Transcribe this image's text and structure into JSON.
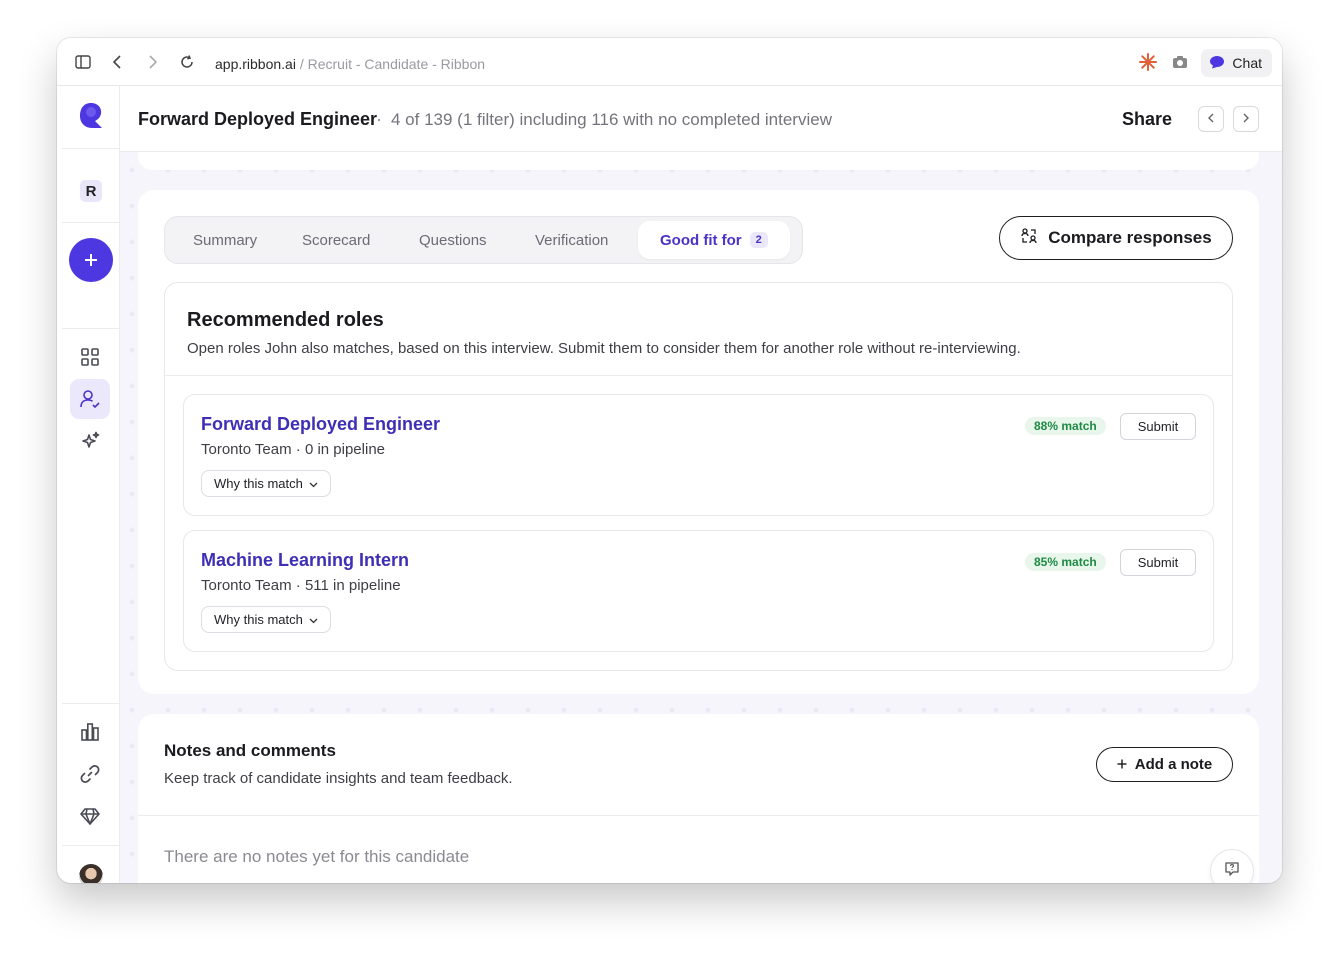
{
  "browser": {
    "url_domain": "app.ribbon.ai",
    "url_path": " / Recruit - Candidate - Ribbon",
    "chat_label": "Chat"
  },
  "rail": {
    "workspace_initial": "R",
    "new_label": "+"
  },
  "header": {
    "title": "Forward Deployed Engineer",
    "separator": "·",
    "subtitle": "4 of 139 (1 filter) including 116 with no completed interview",
    "share_label": "Share"
  },
  "tabs": [
    {
      "label": "Summary"
    },
    {
      "label": "Scorecard"
    },
    {
      "label": "Questions"
    },
    {
      "label": "Verification"
    },
    {
      "label": "Good fit for",
      "count": "2"
    }
  ],
  "compare_label": "Compare responses",
  "recommended": {
    "title": "Recommended roles",
    "description": "Open roles John also matches, based on this interview. Submit them to consider them for another role without re-interviewing.",
    "roles": [
      {
        "name": "Forward Deployed Engineer",
        "meta": "Toronto Team · 0 in pipeline",
        "match": "88% match",
        "why_label": "Why this match",
        "submit_label": "Submit"
      },
      {
        "name": "Machine Learning Intern",
        "meta": "Toronto Team · 511 in pipeline",
        "match": "85% match",
        "why_label": "Why this match",
        "submit_label": "Submit"
      }
    ]
  },
  "notes": {
    "title": "Notes and comments",
    "description": "Keep track of candidate insights and team feedback.",
    "add_label": "Add a note",
    "empty": "There are no notes yet for this candidate"
  },
  "colors": {
    "accent": "#4b33c8",
    "primary_button": "#4c37e0",
    "match_green": "#1f8a44"
  }
}
